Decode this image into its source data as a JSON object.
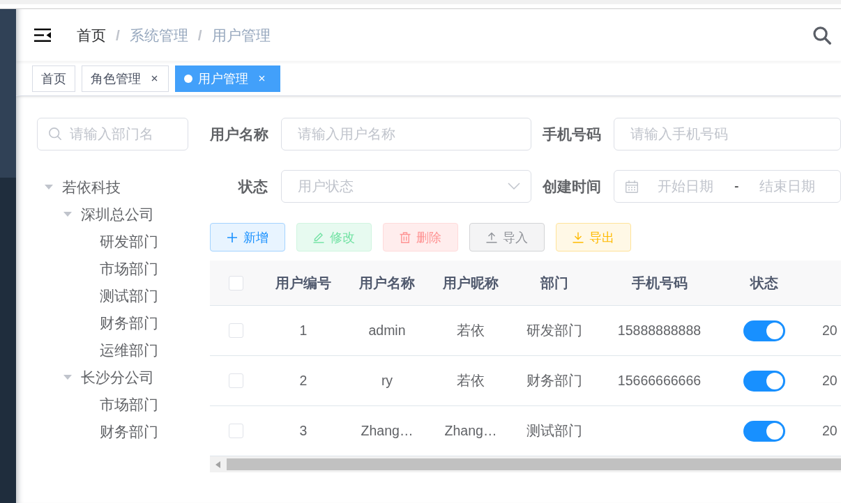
{
  "breadcrumb": [
    {
      "kind": "link",
      "label": "首页"
    },
    {
      "kind": "separator",
      "label": "/"
    },
    {
      "kind": "text",
      "label": "系统管理"
    },
    {
      "kind": "separator",
      "label": "/"
    },
    {
      "kind": "text",
      "label": "用户管理"
    }
  ],
  "tags": [
    {
      "label": "首页",
      "selected": false,
      "closable": false
    },
    {
      "label": "角色管理",
      "selected": false,
      "closable": true
    },
    {
      "label": "用户管理",
      "selected": true,
      "closable": true
    }
  ],
  "dept_search": {
    "placeholder": "请输入部门名"
  },
  "dept_tree": [
    {
      "label": "若依科技",
      "expanded": true,
      "children": [
        {
          "label": "深圳总公司",
          "expanded": true,
          "children": [
            {
              "label": "研发部门"
            },
            {
              "label": "市场部门"
            },
            {
              "label": "测试部门"
            },
            {
              "label": "财务部门"
            },
            {
              "label": "运维部门"
            }
          ]
        },
        {
          "label": "长沙分公司",
          "expanded": true,
          "children": [
            {
              "label": "市场部门"
            },
            {
              "label": "财务部门"
            }
          ]
        }
      ]
    }
  ],
  "filters": [
    {
      "kind": "text",
      "label": "用户名称",
      "placeholder": "请输入用户名称"
    },
    {
      "kind": "text",
      "label": "手机号码",
      "placeholder": "请输入手机号码"
    },
    {
      "kind": "select",
      "label": "状态",
      "placeholder": "用户状态"
    },
    {
      "kind": "daterange",
      "label": "创建时间",
      "start_placeholder": "开始日期",
      "separator": "-",
      "end_placeholder": "结束日期"
    }
  ],
  "toolbar": [
    {
      "kind": "add",
      "label": "新增",
      "disabled": false
    },
    {
      "kind": "edit",
      "label": "修改",
      "disabled": true
    },
    {
      "kind": "delete",
      "label": "删除",
      "disabled": true
    },
    {
      "kind": "import",
      "label": "导入",
      "disabled": false
    },
    {
      "kind": "export",
      "label": "导出",
      "disabled": false
    }
  ],
  "table": {
    "select_all": {
      "checked": false
    },
    "columns": [
      "用户编号",
      "用户名称",
      "用户昵称",
      "部门",
      "手机号码",
      "状态"
    ],
    "rows": [
      {
        "checked": false,
        "user_id": "1",
        "user_name": "admin",
        "nickname": "若依",
        "department": "研发部门",
        "phone": "15888888888",
        "enabled": true,
        "column_8": "20"
      },
      {
        "checked": false,
        "user_id": "2",
        "user_name": "ry",
        "nickname": "若依",
        "department": "财务部门",
        "phone": "15666666666",
        "enabled": true,
        "column_8": "20"
      },
      {
        "checked": false,
        "user_id": "3",
        "user_name": "Zhang…",
        "nickname": "Zhang…",
        "department": "测试部门",
        "enabled": true,
        "column_8": "20"
      }
    ]
  }
}
